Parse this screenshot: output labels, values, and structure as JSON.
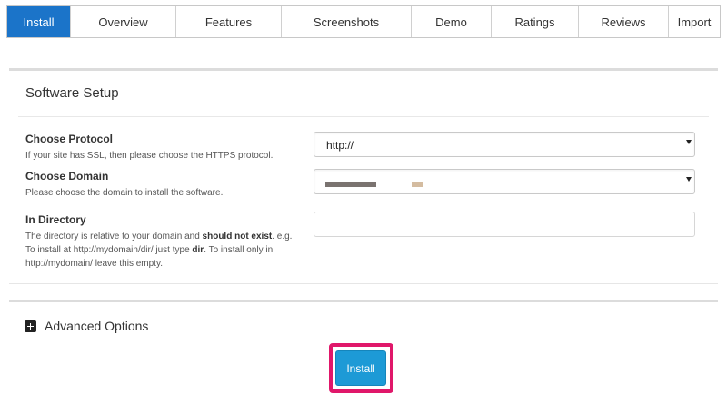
{
  "tabs": [
    {
      "label": "Install",
      "active": true
    },
    {
      "label": "Overview"
    },
    {
      "label": "Features"
    },
    {
      "label": "Screenshots"
    },
    {
      "label": "Demo"
    },
    {
      "label": "Ratings"
    },
    {
      "label": "Reviews"
    },
    {
      "label": "Import"
    }
  ],
  "setup": {
    "title": "Software Setup",
    "protocol": {
      "label": "Choose Protocol",
      "help": "If your site has SSL, then please choose the HTTPS protocol.",
      "selected": "http://"
    },
    "domain": {
      "label": "Choose Domain",
      "help": "Please choose the domain to install the software.",
      "selected": "",
      "redaction_colors": [
        "#7a7370",
        "#d4bca0"
      ]
    },
    "directory": {
      "label": "In Directory",
      "help_part1": "The directory is relative to your domain and ",
      "help_bold1": "should not exist",
      "help_part2": ". e.g. To install at http://mydomain/dir/ just type ",
      "help_bold2": "dir",
      "help_part3": ". To install only in http://mydomain/ leave this empty.",
      "value": ""
    }
  },
  "advanced": {
    "label": "Advanced Options"
  },
  "install_button": "Install",
  "colors": {
    "active_tab": "#1b74c9",
    "install_button": "#1d9ad6",
    "highlight": "#e0176a"
  }
}
